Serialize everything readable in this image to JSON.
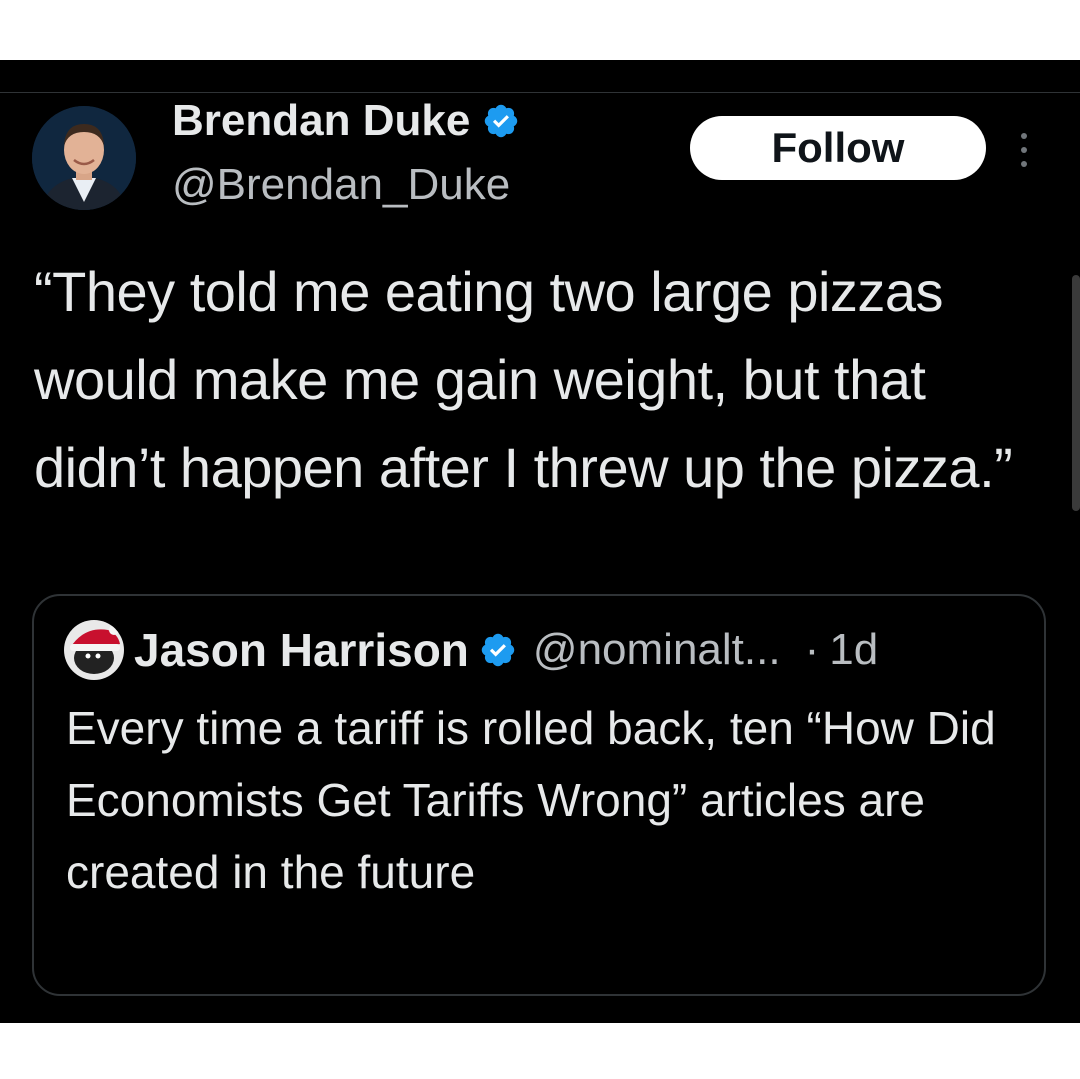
{
  "tweet": {
    "author": {
      "name": "Brendan Duke",
      "handle": "@Brendan_Duke",
      "verified": true
    },
    "follow_label": "Follow",
    "text": "“They told me eating two large pizzas would make me gain weight, but that didn’t happen after I threw up the pizza.”"
  },
  "quoted_tweet": {
    "author": {
      "name": "Jason Harrison",
      "handle": "@nominalt...",
      "verified": true
    },
    "separator": "·",
    "time": "1d",
    "text": "Every time a tariff is rolled back, ten “How Did Economists Get Tariffs Wrong” articles are created in the future"
  },
  "icons": {
    "verified": "verified-badge-icon",
    "more": "more-options-icon"
  },
  "colors": {
    "background": "#000000",
    "text_primary": "#e7e9ea",
    "text_secondary": "#b9bdc1",
    "verified_blue": "#1d9bf0",
    "follow_button_bg": "#ffffff",
    "border": "#2f3336"
  }
}
